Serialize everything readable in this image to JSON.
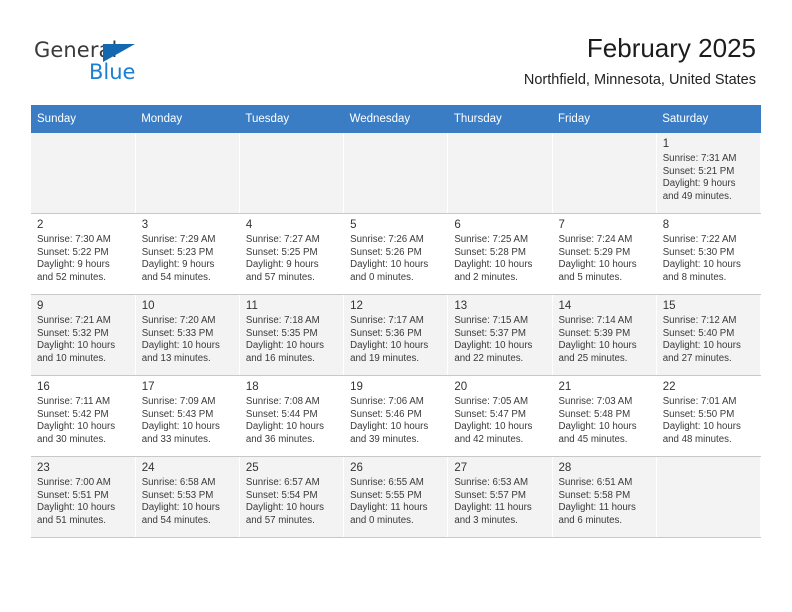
{
  "brand": {
    "name_part1": "General",
    "name_part2": "Blue",
    "logo_icon": "triangle-logo-icon"
  },
  "header": {
    "title": "February 2025",
    "subtitle": "Northfield, Minnesota, United States"
  },
  "calendar": {
    "weekday_headers": [
      "Sunday",
      "Monday",
      "Tuesday",
      "Wednesday",
      "Thursday",
      "Friday",
      "Saturday"
    ],
    "accent_color": "#3b7dc4",
    "weeks": [
      [
        {
          "day": "",
          "empty": true
        },
        {
          "day": "",
          "empty": true
        },
        {
          "day": "",
          "empty": true
        },
        {
          "day": "",
          "empty": true
        },
        {
          "day": "",
          "empty": true
        },
        {
          "day": "",
          "empty": true
        },
        {
          "day": "1",
          "sunrise": "Sunrise: 7:31 AM",
          "sunset": "Sunset: 5:21 PM",
          "daylight1": "Daylight: 9 hours",
          "daylight2": "and 49 minutes."
        }
      ],
      [
        {
          "day": "2",
          "sunrise": "Sunrise: 7:30 AM",
          "sunset": "Sunset: 5:22 PM",
          "daylight1": "Daylight: 9 hours",
          "daylight2": "and 52 minutes."
        },
        {
          "day": "3",
          "sunrise": "Sunrise: 7:29 AM",
          "sunset": "Sunset: 5:23 PM",
          "daylight1": "Daylight: 9 hours",
          "daylight2": "and 54 minutes."
        },
        {
          "day": "4",
          "sunrise": "Sunrise: 7:27 AM",
          "sunset": "Sunset: 5:25 PM",
          "daylight1": "Daylight: 9 hours",
          "daylight2": "and 57 minutes."
        },
        {
          "day": "5",
          "sunrise": "Sunrise: 7:26 AM",
          "sunset": "Sunset: 5:26 PM",
          "daylight1": "Daylight: 10 hours",
          "daylight2": "and 0 minutes."
        },
        {
          "day": "6",
          "sunrise": "Sunrise: 7:25 AM",
          "sunset": "Sunset: 5:28 PM",
          "daylight1": "Daylight: 10 hours",
          "daylight2": "and 2 minutes."
        },
        {
          "day": "7",
          "sunrise": "Sunrise: 7:24 AM",
          "sunset": "Sunset: 5:29 PM",
          "daylight1": "Daylight: 10 hours",
          "daylight2": "and 5 minutes."
        },
        {
          "day": "8",
          "sunrise": "Sunrise: 7:22 AM",
          "sunset": "Sunset: 5:30 PM",
          "daylight1": "Daylight: 10 hours",
          "daylight2": "and 8 minutes."
        }
      ],
      [
        {
          "day": "9",
          "sunrise": "Sunrise: 7:21 AM",
          "sunset": "Sunset: 5:32 PM",
          "daylight1": "Daylight: 10 hours",
          "daylight2": "and 10 minutes."
        },
        {
          "day": "10",
          "sunrise": "Sunrise: 7:20 AM",
          "sunset": "Sunset: 5:33 PM",
          "daylight1": "Daylight: 10 hours",
          "daylight2": "and 13 minutes."
        },
        {
          "day": "11",
          "sunrise": "Sunrise: 7:18 AM",
          "sunset": "Sunset: 5:35 PM",
          "daylight1": "Daylight: 10 hours",
          "daylight2": "and 16 minutes."
        },
        {
          "day": "12",
          "sunrise": "Sunrise: 7:17 AM",
          "sunset": "Sunset: 5:36 PM",
          "daylight1": "Daylight: 10 hours",
          "daylight2": "and 19 minutes."
        },
        {
          "day": "13",
          "sunrise": "Sunrise: 7:15 AM",
          "sunset": "Sunset: 5:37 PM",
          "daylight1": "Daylight: 10 hours",
          "daylight2": "and 22 minutes."
        },
        {
          "day": "14",
          "sunrise": "Sunrise: 7:14 AM",
          "sunset": "Sunset: 5:39 PM",
          "daylight1": "Daylight: 10 hours",
          "daylight2": "and 25 minutes."
        },
        {
          "day": "15",
          "sunrise": "Sunrise: 7:12 AM",
          "sunset": "Sunset: 5:40 PM",
          "daylight1": "Daylight: 10 hours",
          "daylight2": "and 27 minutes."
        }
      ],
      [
        {
          "day": "16",
          "sunrise": "Sunrise: 7:11 AM",
          "sunset": "Sunset: 5:42 PM",
          "daylight1": "Daylight: 10 hours",
          "daylight2": "and 30 minutes."
        },
        {
          "day": "17",
          "sunrise": "Sunrise: 7:09 AM",
          "sunset": "Sunset: 5:43 PM",
          "daylight1": "Daylight: 10 hours",
          "daylight2": "and 33 minutes."
        },
        {
          "day": "18",
          "sunrise": "Sunrise: 7:08 AM",
          "sunset": "Sunset: 5:44 PM",
          "daylight1": "Daylight: 10 hours",
          "daylight2": "and 36 minutes."
        },
        {
          "day": "19",
          "sunrise": "Sunrise: 7:06 AM",
          "sunset": "Sunset: 5:46 PM",
          "daylight1": "Daylight: 10 hours",
          "daylight2": "and 39 minutes."
        },
        {
          "day": "20",
          "sunrise": "Sunrise: 7:05 AM",
          "sunset": "Sunset: 5:47 PM",
          "daylight1": "Daylight: 10 hours",
          "daylight2": "and 42 minutes."
        },
        {
          "day": "21",
          "sunrise": "Sunrise: 7:03 AM",
          "sunset": "Sunset: 5:48 PM",
          "daylight1": "Daylight: 10 hours",
          "daylight2": "and 45 minutes."
        },
        {
          "day": "22",
          "sunrise": "Sunrise: 7:01 AM",
          "sunset": "Sunset: 5:50 PM",
          "daylight1": "Daylight: 10 hours",
          "daylight2": "and 48 minutes."
        }
      ],
      [
        {
          "day": "23",
          "sunrise": "Sunrise: 7:00 AM",
          "sunset": "Sunset: 5:51 PM",
          "daylight1": "Daylight: 10 hours",
          "daylight2": "and 51 minutes."
        },
        {
          "day": "24",
          "sunrise": "Sunrise: 6:58 AM",
          "sunset": "Sunset: 5:53 PM",
          "daylight1": "Daylight: 10 hours",
          "daylight2": "and 54 minutes."
        },
        {
          "day": "25",
          "sunrise": "Sunrise: 6:57 AM",
          "sunset": "Sunset: 5:54 PM",
          "daylight1": "Daylight: 10 hours",
          "daylight2": "and 57 minutes."
        },
        {
          "day": "26",
          "sunrise": "Sunrise: 6:55 AM",
          "sunset": "Sunset: 5:55 PM",
          "daylight1": "Daylight: 11 hours",
          "daylight2": "and 0 minutes."
        },
        {
          "day": "27",
          "sunrise": "Sunrise: 6:53 AM",
          "sunset": "Sunset: 5:57 PM",
          "daylight1": "Daylight: 11 hours",
          "daylight2": "and 3 minutes."
        },
        {
          "day": "28",
          "sunrise": "Sunrise: 6:51 AM",
          "sunset": "Sunset: 5:58 PM",
          "daylight1": "Daylight: 11 hours",
          "daylight2": "and 6 minutes."
        },
        {
          "day": "",
          "empty": true
        }
      ]
    ]
  }
}
